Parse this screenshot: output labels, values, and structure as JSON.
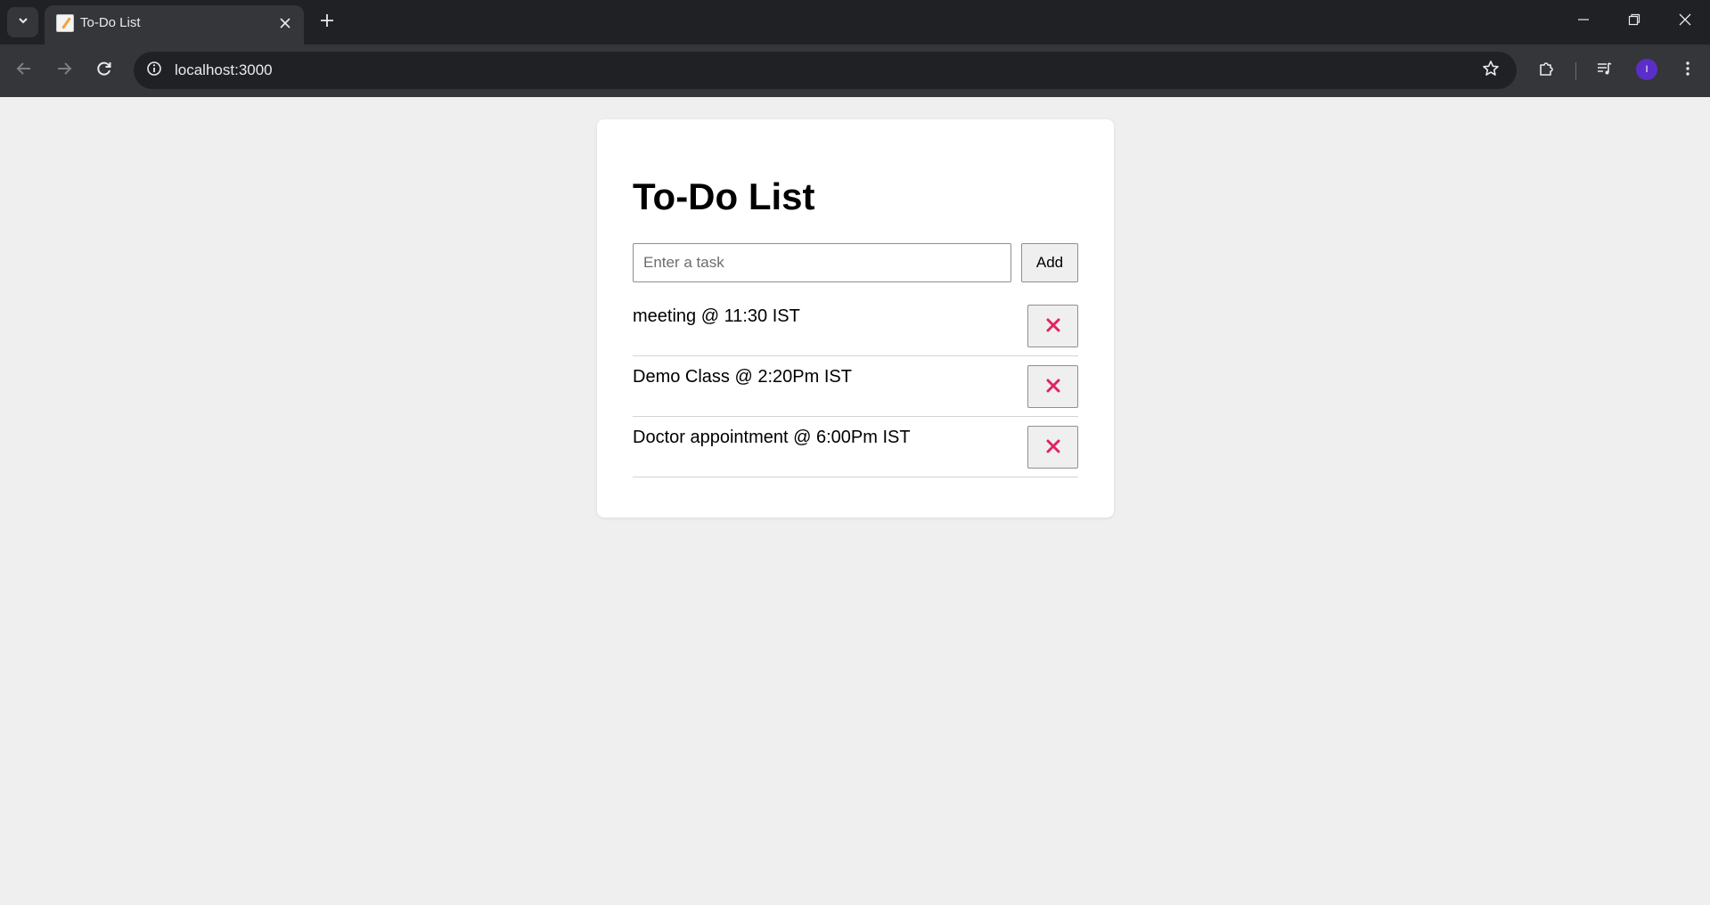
{
  "browser": {
    "tab_title": "To-Do List",
    "url": "localhost:3000",
    "profile_initial": "I"
  },
  "app": {
    "title": "To-Do List",
    "input": {
      "value": "",
      "placeholder": "Enter a task"
    },
    "add_label": "Add",
    "tasks": [
      {
        "text": "meeting @ 11:30 IST"
      },
      {
        "text": "Demo Class @ 2:20Pm IST"
      },
      {
        "text": "Doctor appointment @ 6:00Pm IST"
      }
    ]
  },
  "colors": {
    "delete_icon": "#e0245e",
    "page_bg": "#efefef",
    "card_bg": "#ffffff",
    "avatar": "#5b2ec8"
  },
  "icons": {
    "tab_search": "chevron-down-icon",
    "favicon": "memo-icon",
    "tab_close": "close-icon",
    "new_tab": "plus-icon",
    "back": "arrow-left-icon",
    "forward": "arrow-right-icon",
    "reload": "reload-icon",
    "site_info": "info-icon",
    "bookmark": "star-icon",
    "extensions": "puzzle-icon",
    "media": "media-queue-icon",
    "menu": "kebab-menu-icon",
    "delete": "x-icon"
  }
}
